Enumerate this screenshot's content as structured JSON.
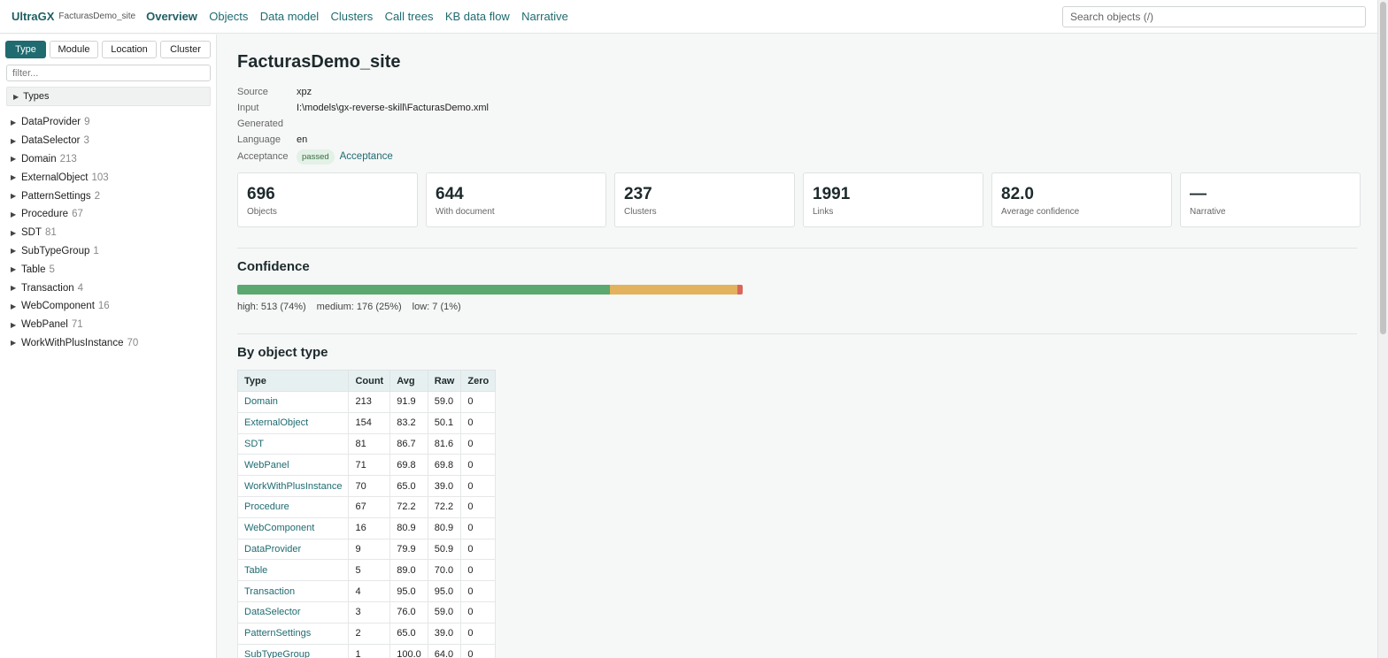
{
  "header": {
    "brand": "UltraGX",
    "site": "FacturasDemo_site",
    "nav": [
      "Overview",
      "Objects",
      "Data model",
      "Clusters",
      "Call trees",
      "KB data flow",
      "Narrative"
    ],
    "search_placeholder": "Search objects (/)"
  },
  "sidebar": {
    "tabs": [
      "Type",
      "Module",
      "Location",
      "Cluster"
    ],
    "filter_placeholder": "filter...",
    "group_label": "Types",
    "items": [
      {
        "label": "DataProvider",
        "count": "9"
      },
      {
        "label": "DataSelector",
        "count": "3"
      },
      {
        "label": "Domain",
        "count": "213"
      },
      {
        "label": "ExternalObject",
        "count": "103"
      },
      {
        "label": "PatternSettings",
        "count": "2"
      },
      {
        "label": "Procedure",
        "count": "67"
      },
      {
        "label": "SDT",
        "count": "81"
      },
      {
        "label": "SubTypeGroup",
        "count": "1"
      },
      {
        "label": "Table",
        "count": "5"
      },
      {
        "label": "Transaction",
        "count": "4"
      },
      {
        "label": "WebComponent",
        "count": "16"
      },
      {
        "label": "WebPanel",
        "count": "71"
      },
      {
        "label": "WorkWithPlusInstance",
        "count": "70"
      }
    ]
  },
  "main": {
    "title": "FacturasDemo_site",
    "meta": {
      "source_label": "Source",
      "source": "xpz",
      "input_label": "Input",
      "input": "I:\\models\\gx-reverse-skill\\FacturasDemo.xml",
      "generated_label": "Generated",
      "generated": "",
      "language_label": "Language",
      "language": "en",
      "acceptance_label": "Acceptance",
      "acceptance_status": "passed",
      "acceptance_link": "Acceptance"
    },
    "cards": [
      {
        "value": "696",
        "label": "Objects"
      },
      {
        "value": "644",
        "label": "With document"
      },
      {
        "value": "237",
        "label": "Clusters"
      },
      {
        "value": "1991",
        "label": "Links"
      },
      {
        "value": "82.0",
        "label": "Average confidence"
      },
      {
        "value": "—",
        "label": "Narrative"
      }
    ],
    "confidence": {
      "heading": "Confidence",
      "high": 513,
      "medium": 176,
      "low": 7,
      "high_label": "high: 513 (74%)",
      "medium_label": "medium: 176 (25%)",
      "low_label": "low: 7 (1%)",
      "colors": {
        "high": "#5ba870",
        "medium": "#e3b25c",
        "low": "#d9665c"
      }
    },
    "by_type": {
      "heading": "By object type",
      "columns": [
        "Type",
        "Count",
        "Avg",
        "Raw",
        "Zero"
      ],
      "rows": [
        [
          "Domain",
          "213",
          "91.9",
          "59.0",
          "0"
        ],
        [
          "ExternalObject",
          "154",
          "83.2",
          "50.1",
          "0"
        ],
        [
          "SDT",
          "81",
          "86.7",
          "81.6",
          "0"
        ],
        [
          "WebPanel",
          "71",
          "69.8",
          "69.8",
          "0"
        ],
        [
          "WorkWithPlusInstance",
          "70",
          "65.0",
          "39.0",
          "0"
        ],
        [
          "Procedure",
          "67",
          "72.2",
          "72.2",
          "0"
        ],
        [
          "WebComponent",
          "16",
          "80.9",
          "80.9",
          "0"
        ],
        [
          "DataProvider",
          "9",
          "79.9",
          "50.9",
          "0"
        ],
        [
          "Table",
          "5",
          "89.0",
          "70.0",
          "0"
        ],
        [
          "Transaction",
          "4",
          "95.0",
          "95.0",
          "0"
        ],
        [
          "DataSelector",
          "3",
          "76.0",
          "59.0",
          "0"
        ],
        [
          "PatternSettings",
          "2",
          "65.0",
          "39.0",
          "0"
        ],
        [
          "SubTypeGroup",
          "1",
          "100.0",
          "64.0",
          "0"
        ]
      ]
    }
  }
}
